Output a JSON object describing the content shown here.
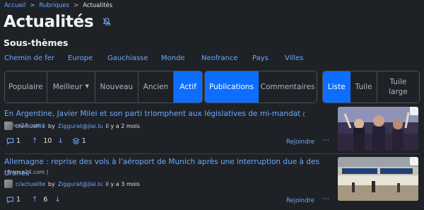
{
  "breadcrumb": {
    "home": "Accueil",
    "section": "Rubriques",
    "current": "Actualités",
    "sep": ">"
  },
  "page": {
    "title": "Actualités",
    "subtitle": "Sous-thèmes"
  },
  "subthemes": [
    "Chemin de fer",
    "Europe",
    "Gauchiasse",
    "Monde",
    "Neofrance",
    "Pays",
    "Villes"
  ],
  "sort": {
    "options": [
      "Populaire",
      "Meilleur",
      "Nouveau",
      "Ancien",
      "Actif"
    ],
    "active": "Actif"
  },
  "view_type": {
    "options": [
      "Publications",
      "Commentaires"
    ],
    "active": "Publications"
  },
  "layout": {
    "options": [
      "Liste",
      "Tuile",
      "Tuile large"
    ],
    "active": "Liste"
  },
  "posts": [
    {
      "title": "En Argentine, Javier Milei et son parti triomphent aux législatives de mi-mandat",
      "domain": "( france24.com )",
      "community": "c/actualite",
      "by": "by",
      "author": "Ziggurat@jlai.lu",
      "time": "il y a 2 mois",
      "comments": "1",
      "score": "10",
      "crossposts": "1",
      "join": "Rejoindre",
      "more": "⋯"
    },
    {
      "title": "Allemagne : reprise des vols à l'aéroport de Munich après une interruption due à des drones",
      "domain": "( france24.com )",
      "community": "c/actualite",
      "by": "by",
      "author": "Ziggurat@jlai.lu",
      "time": "il y a 3 mois",
      "comments": "1",
      "score": "6",
      "join": "Rejoindre",
      "more": "⋯"
    }
  ],
  "colors": {
    "background": "#1e2226",
    "link": "#6ea8fe",
    "accent": "#0d6efd"
  }
}
